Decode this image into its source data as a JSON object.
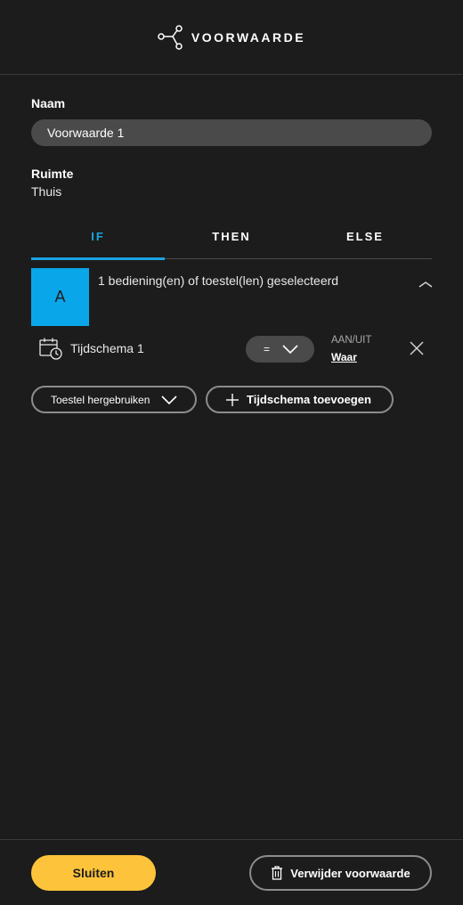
{
  "header": {
    "title": "VOORWAARDE",
    "icon": "condition-branch-icon"
  },
  "form": {
    "name_label": "Naam",
    "name_value": "Voorwaarde 1",
    "room_label": "Ruimte",
    "room_value": "Thuis"
  },
  "tabs": [
    {
      "label": "IF",
      "active": true
    },
    {
      "label": "THEN",
      "active": false
    },
    {
      "label": "ELSE",
      "active": false
    }
  ],
  "condition": {
    "device_letter": "A",
    "device_color": "#0aa6ea",
    "selected_text": "1 bediening(en) of toestel(len) geselecteerd",
    "rule": {
      "icon": "schedule-icon",
      "label": "Tijdschema 1",
      "operator": "=",
      "state_label": "AAN/UIT",
      "state_value": "Waar"
    }
  },
  "actions": {
    "reuse_label": "Toestel hergebruiken",
    "add_schedule_label": "Tijdschema toevoegen"
  },
  "footer": {
    "close_label": "Sluiten",
    "delete_label": "Verwijder voorwaarde"
  },
  "colors": {
    "accent_blue": "#1aa3e0",
    "primary_yellow": "#fdc43b",
    "background": "#1c1c1c"
  }
}
